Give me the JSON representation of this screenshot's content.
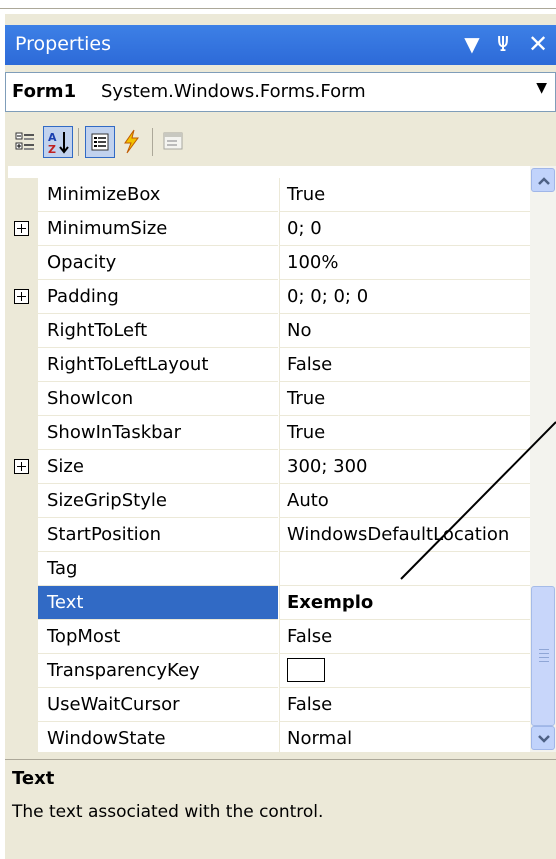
{
  "window": {
    "title": "Properties",
    "dropdown_icon": "triangle-down-icon",
    "pin_icon": "pin-icon",
    "close_icon": "close-icon",
    "pin_glyph": "Ψ",
    "close_glyph": "✕",
    "drop_glyph": "▼"
  },
  "object_selector": {
    "name": "Form1",
    "type": "System.Windows.Forms.Form",
    "arrow": "▼"
  },
  "toolbar": {
    "buttons": [
      {
        "icon": "categorized-icon",
        "pressed": false
      },
      {
        "icon": "alphabetical-sort-icon",
        "pressed": true
      },
      {
        "icon": "properties-icon",
        "pressed": true
      },
      {
        "icon": "events-lightning-icon",
        "pressed": false
      },
      {
        "icon": "property-pages-icon",
        "pressed": false
      }
    ]
  },
  "properties": [
    {
      "name": "MinimizeBox",
      "value": "True",
      "expandable": false
    },
    {
      "name": "MinimumSize",
      "value": "0; 0",
      "expandable": true
    },
    {
      "name": "Opacity",
      "value": "100%",
      "expandable": false
    },
    {
      "name": "Padding",
      "value": "0; 0; 0; 0",
      "expandable": true
    },
    {
      "name": "RightToLeft",
      "value": "No",
      "expandable": false
    },
    {
      "name": "RightToLeftLayout",
      "value": "False",
      "expandable": false
    },
    {
      "name": "ShowIcon",
      "value": "True",
      "expandable": false
    },
    {
      "name": "ShowInTaskbar",
      "value": "True",
      "expandable": false
    },
    {
      "name": "Size",
      "value": "300; 300",
      "expandable": true
    },
    {
      "name": "SizeGripStyle",
      "value": "Auto",
      "expandable": false
    },
    {
      "name": "StartPosition",
      "value": "WindowsDefaultLocation",
      "expandable": false
    },
    {
      "name": "Tag",
      "value": "",
      "expandable": false
    },
    {
      "name": "Text",
      "value": "Exemplo",
      "expandable": false,
      "selected": true
    },
    {
      "name": "TopMost",
      "value": "False",
      "expandable": false
    },
    {
      "name": "TransparencyKey",
      "value": "",
      "expandable": false,
      "color_swatch": "#ffffff"
    },
    {
      "name": "UseWaitCursor",
      "value": "False",
      "expandable": false
    },
    {
      "name": "WindowState",
      "value": "Normal",
      "expandable": false
    }
  ],
  "description": {
    "title": "Text",
    "text": "The text associated with the control."
  },
  "colors": {
    "title_bar": "#2d6ad8",
    "selection": "#316ac5",
    "panel": "#ece9d8"
  }
}
